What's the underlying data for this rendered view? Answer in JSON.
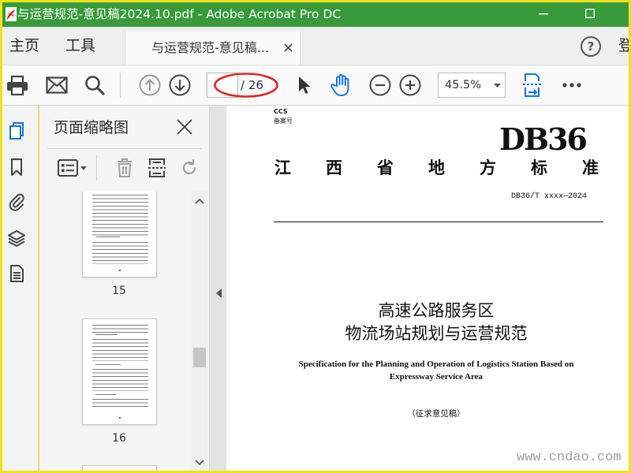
{
  "window": {
    "title": "与运营规范-意见稿2024.10.pdf - Adobe Acrobat Pro DC"
  },
  "menu": {
    "home": "主页",
    "tools": "工具",
    "document_tab": "与运营规范-意见稿...",
    "help": "?",
    "sign_in": "登"
  },
  "toolbar": {
    "page_total": "/ 26",
    "zoom": "45.5%"
  },
  "thumbnails": {
    "title": "页面缩略图",
    "pages": [
      {
        "label": "15"
      },
      {
        "label": "16"
      }
    ]
  },
  "document": {
    "ccs": "CCS",
    "record_number": "备案号",
    "logo": "DB36",
    "standard_type": "江 西 省 地 方 标 准",
    "code": "DB36/T xxxx—2024",
    "title_line1": "高速公路服务区",
    "title_line2": "物流场站规划与运营规范",
    "title_en_line1": "Specification for the Planning and Operation of Logistics Station Based on",
    "title_en_line2": "Expressway Service Area",
    "status": "（征求意见稿）"
  },
  "watermark": "www.cndao.com",
  "colors": {
    "title_bar": "#389a3b",
    "acrobat_blue": "#1473e6",
    "annotation_red": "#e3231b",
    "frame_yellow": "#f0e21a"
  },
  "icons": {
    "title_bar": [
      "pdf-file-icon",
      "minimize-icon",
      "maximize-icon"
    ],
    "toolbar": [
      "print-icon",
      "email-icon",
      "search-icon",
      "previous-page-icon",
      "next-page-icon",
      "select-cursor-icon",
      "hand-tool-icon",
      "zoom-out-icon",
      "zoom-in-icon",
      "chevron-down-icon",
      "scroll-mode-icon",
      "more-icon"
    ],
    "left_rail": [
      "page-thumbnails-icon",
      "bookmarks-icon",
      "attachments-icon",
      "layers-icon",
      "document-icon"
    ],
    "thumbnails_panel": [
      "close-icon",
      "thumbnail-options-icon",
      "delete-page-icon",
      "insert-page-icon",
      "rotate-page-icon"
    ]
  }
}
